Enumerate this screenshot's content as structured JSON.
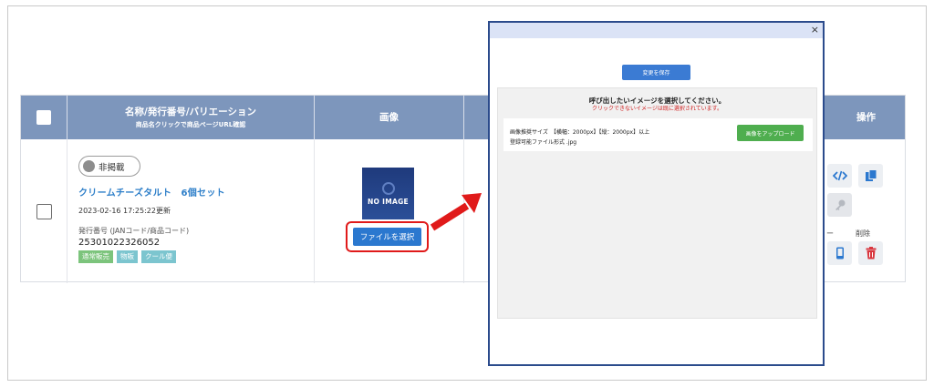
{
  "table": {
    "headers": {
      "name_title": "名称/発行番号/バリエーション",
      "name_sub": "商品名クリックで商品ページURL確認",
      "image": "画像",
      "ops": "操作"
    },
    "row": {
      "status": "非掲載",
      "product_name": "クリームチーズタルト　6個セット",
      "updated": "2023-02-16 17:25:22更新",
      "issue_label": "発行番号 (JANコード/商品コード)",
      "issue_no": "25301022326052",
      "tags": [
        "通常販売",
        "物販",
        "クール便"
      ],
      "noimage_text": "NO IMAGE",
      "file_button": "ファイルを選択"
    },
    "ops": {
      "dash": "ー",
      "delete_label": "削除"
    }
  },
  "modal": {
    "close": "×",
    "save_button": "変更を保存",
    "panel_title": "呼び出したいイメージを選択してください。",
    "panel_warning": "クリックできないイメージは既に選択されています。",
    "spec_size": "画像推奨サイズ　【横幅：2000px】【縦：2000px】以上",
    "spec_format": "登録可能ファイル形式 .jpg",
    "upload_button": "画像をアップロード"
  },
  "colors": {
    "header_bg": "#7d96bc",
    "link": "#2e7fc9",
    "highlight": "#e01a1a",
    "primary_button": "#2b78cf",
    "upload_button": "#4fae4f",
    "delete_icon": "#d9363e"
  },
  "icons": [
    "code-icon",
    "copy-icon",
    "key-icon",
    "mobile-icon",
    "trash-icon",
    "close-icon",
    "arrow-icon"
  ]
}
